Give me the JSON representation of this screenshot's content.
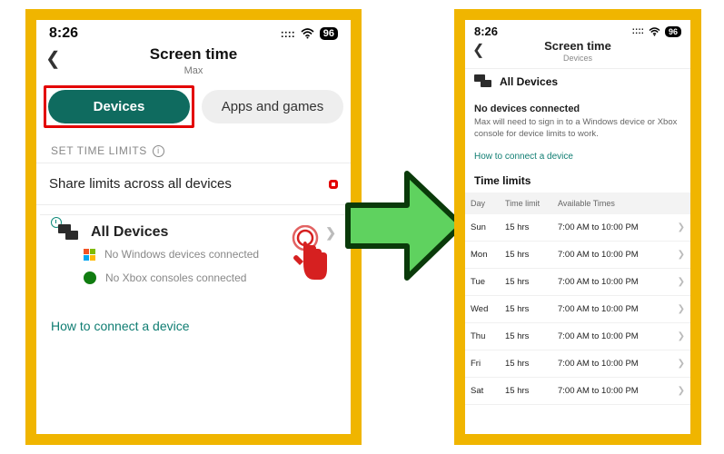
{
  "left": {
    "status": {
      "time": "8:26",
      "signal": "::::",
      "wifi": "▶",
      "battery": "96"
    },
    "header": {
      "title": "Screen time",
      "subtitle": "Max"
    },
    "tabs": {
      "devices": "Devices",
      "apps": "Apps and games"
    },
    "section_label": "SET TIME LIMITS",
    "share_row": "Share limits across all devices",
    "all_devices": {
      "title": "All Devices",
      "windows_msg": "No Windows devices connected",
      "xbox_msg": "No Xbox consoles connected"
    },
    "connect_link": "How to connect a device"
  },
  "right": {
    "status": {
      "time": "8:26",
      "battery": "96"
    },
    "header": {
      "title": "Screen time",
      "subtitle": "Devices"
    },
    "all_devices_label": "All Devices",
    "no_devices": {
      "title": "No devices connected",
      "body": "Max will need to sign in to a Windows device or Xbox console for device limits to work."
    },
    "connect_link": "How to connect a device",
    "limits_title": "Time limits",
    "table": {
      "head": {
        "day": "Day",
        "limit": "Time limit",
        "avail": "Available Times"
      },
      "rows": [
        {
          "day": "Sun",
          "limit": "15 hrs",
          "avail": "7:00 AM to 10:00 PM"
        },
        {
          "day": "Mon",
          "limit": "15 hrs",
          "avail": "7:00 AM to 10:00 PM"
        },
        {
          "day": "Tue",
          "limit": "15 hrs",
          "avail": "7:00 AM to 10:00 PM"
        },
        {
          "day": "Wed",
          "limit": "15 hrs",
          "avail": "7:00 AM to 10:00 PM"
        },
        {
          "day": "Thu",
          "limit": "15 hrs",
          "avail": "7:00 AM to 10:00 PM"
        },
        {
          "day": "Fri",
          "limit": "15 hrs",
          "avail": "7:00 AM to 10:00 PM"
        },
        {
          "day": "Sat",
          "limit": "15 hrs",
          "avail": "7:00 AM to 10:00 PM"
        }
      ]
    }
  }
}
